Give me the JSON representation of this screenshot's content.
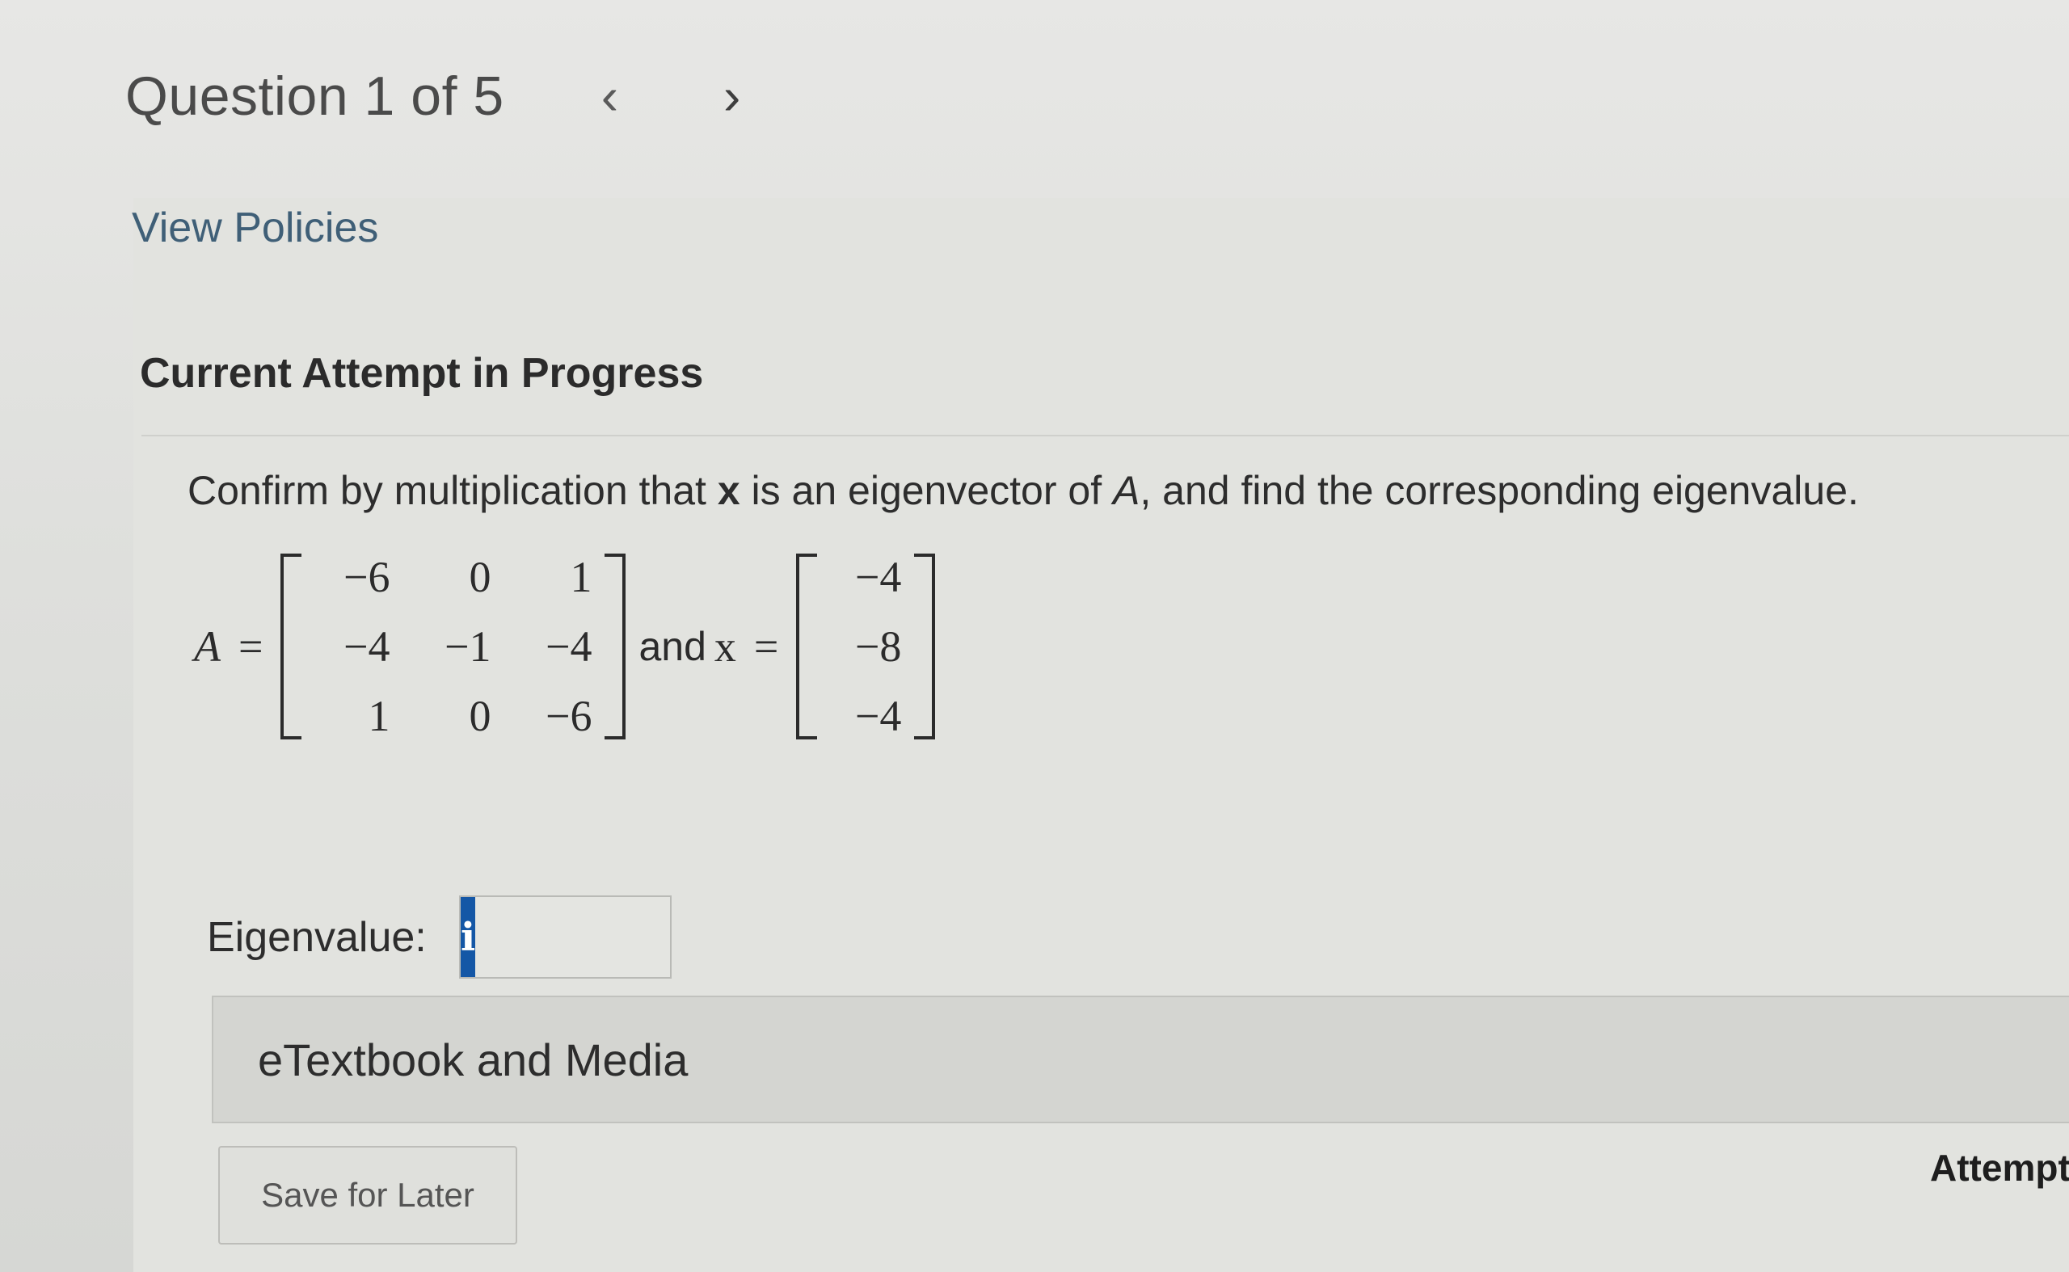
{
  "header": {
    "question_counter": "Question 1 of 5",
    "prev_icon": "chevron-left-icon",
    "prev_glyph": "‹",
    "next_icon": "chevron-right-icon",
    "next_glyph": "›"
  },
  "links": {
    "view_policies": "View Policies"
  },
  "attempt": {
    "title": "Current Attempt in Progress"
  },
  "question": {
    "prefix": "Confirm by multiplication that ",
    "x_symbol": "x",
    "middle": " is an eigenvector of ",
    "a_symbol": "A",
    "suffix": ", and find the corresponding eigenvalue."
  },
  "math": {
    "matrix_name": "A",
    "equals": "=",
    "matrix_A": [
      [
        "−6",
        "0",
        "1"
      ],
      [
        "−4",
        "−1",
        "−4"
      ],
      [
        "1",
        "0",
        "−6"
      ]
    ],
    "and_text": "and",
    "vector_name": "x",
    "vector_x": [
      "−4",
      "−8",
      "−4"
    ]
  },
  "eigenvalue": {
    "label": "Eigenvalue:",
    "info_icon": "info-icon",
    "info_glyph": "i",
    "value": ""
  },
  "etextbook": {
    "label": "eTextbook and Media"
  },
  "actions": {
    "save_label": "Save for Later",
    "attempts_label": "Attempts"
  },
  "colors": {
    "accent": "#1457a6",
    "link": "#3f5f77",
    "background": "#e2e3df"
  }
}
